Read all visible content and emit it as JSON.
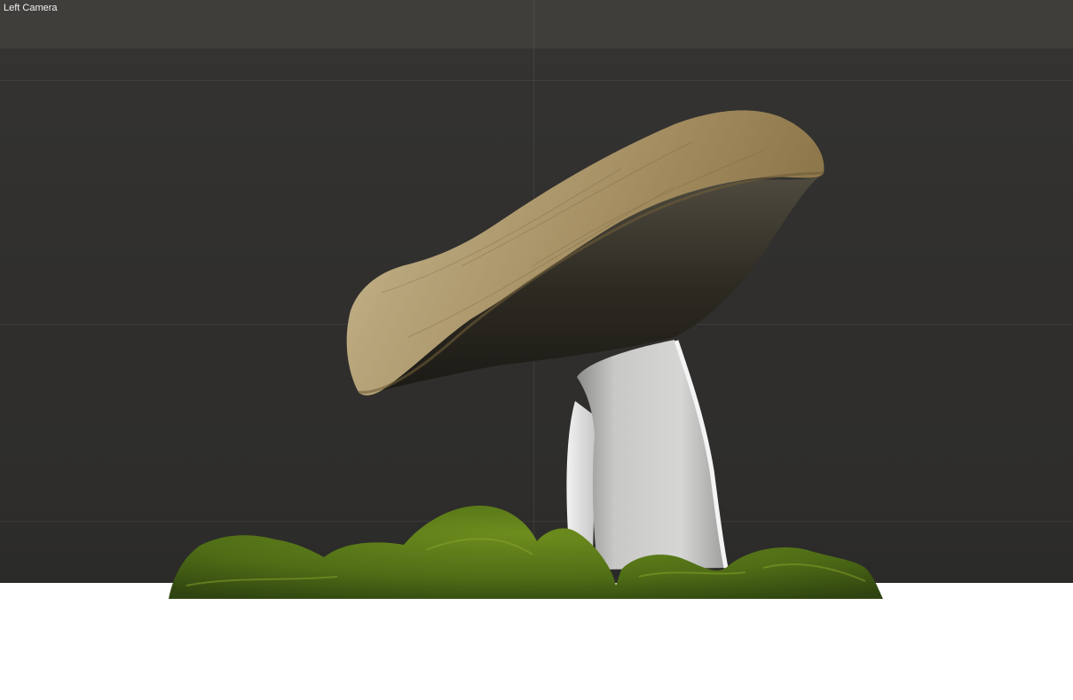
{
  "viewport": {
    "camera_label": "Left Camera"
  },
  "colors": {
    "viewport_top_bar": "#3f3e3b",
    "viewport_background": "#302f2d",
    "below_area": "#ffffff",
    "cap": "#a48e63",
    "gills": "#2d2b22",
    "stem": "#c9c9c7",
    "moss": "#4f6d16"
  }
}
